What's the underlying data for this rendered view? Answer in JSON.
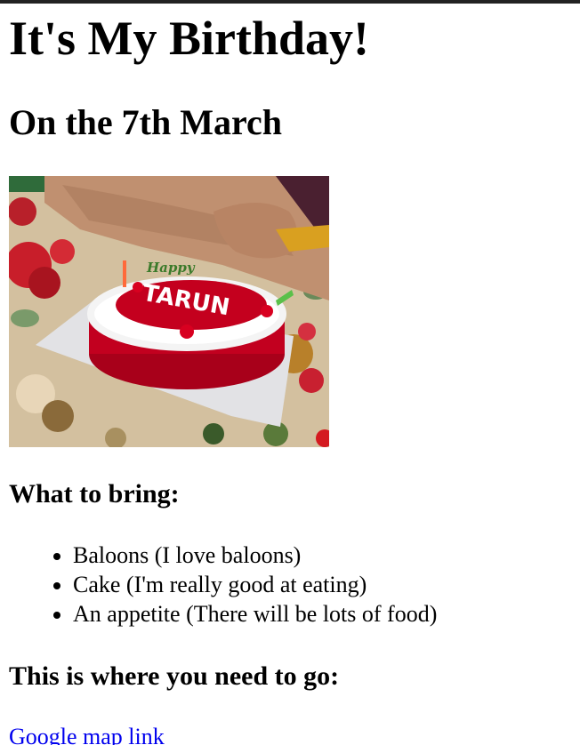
{
  "page": {
    "title": "It's My Birthday!",
    "date": "On the 7th March"
  },
  "photo": {
    "icon": "birthday-cake-photo",
    "cake_text_top": "Happy",
    "cake_text_name": "TARUN"
  },
  "bring": {
    "heading": "What to bring:",
    "items": [
      "Baloons (I love baloons)",
      "Cake (I'm really good at eating)",
      "An appetite (There will be lots of food)"
    ]
  },
  "where": {
    "heading": "This is where you need to go:",
    "link_label": "Google map link"
  },
  "colors": {
    "link": "#0000ee",
    "top_bar": "#222222"
  }
}
